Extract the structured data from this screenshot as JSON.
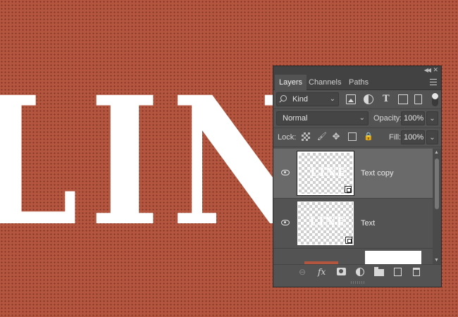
{
  "canvas": {
    "text": "LINE"
  },
  "panel": {
    "tabs": [
      "Layers",
      "Channels",
      "Paths"
    ],
    "filter": {
      "kind_label": "Kind"
    },
    "blend": {
      "mode": "Normal",
      "opacity_label": "Opacity:",
      "opacity_value": "100%"
    },
    "lock": {
      "label": "Lock:",
      "fill_label": "Fill:",
      "fill_value": "100%"
    },
    "layers": [
      {
        "name": "Text copy",
        "selected": true,
        "visible": true,
        "thumb_text": "LINE"
      },
      {
        "name": "Text",
        "selected": false,
        "visible": true,
        "thumb_text": "LINE"
      }
    ]
  },
  "icons": {
    "link": "link-layers-icon",
    "fx": "fx-icon",
    "mask": "add-mask-icon",
    "adjustment": "adjustment-layer-icon",
    "group": "folder-icon",
    "new_layer": "new-layer-icon",
    "delete": "trash-icon",
    "fx_label": "fx"
  },
  "colors": {
    "canvas_bg": "#b3553f",
    "panel_bg": "#535353",
    "selected_row": "#6a6a6a"
  }
}
